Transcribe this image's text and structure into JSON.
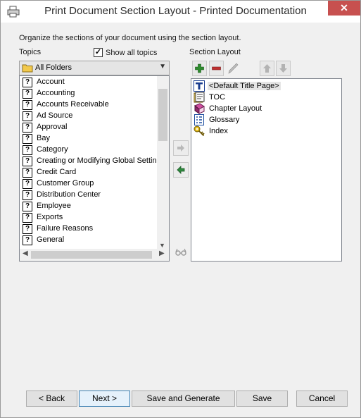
{
  "window": {
    "title": "Print Document Section Layout - Printed Documentation",
    "close_glyph": "✕"
  },
  "instruction": "Organize the sections of your document using the section layout.",
  "topics": {
    "label": "Topics",
    "show_all_label": "Show all topics",
    "show_all_checked": true,
    "folder_selected": "All Folders",
    "items": [
      "Account",
      "Accounting",
      "Accounts Receivable",
      "Ad Source",
      "Approval",
      "Bay",
      "Category",
      "Creating or Modifying Global Settings",
      "Credit Card",
      "Customer Group",
      "Distribution Center",
      "Employee",
      "Exports",
      "Failure Reasons",
      "General"
    ],
    "item_icon": "help-topic-icon",
    "item_icon_glyph": "?"
  },
  "section_layout": {
    "label": "Section Layout",
    "toolbar": [
      "add-icon",
      "remove-icon",
      "edit-pencil-icon",
      "move-up-icon",
      "move-down-icon"
    ],
    "items": [
      {
        "label": "<Default Title Page>",
        "icon": "title-page-icon",
        "selected": true
      },
      {
        "label": "TOC",
        "icon": "toc-book-icon"
      },
      {
        "label": "Chapter Layout",
        "icon": "chapter-book-icon"
      },
      {
        "label": "Glossary",
        "icon": "glossary-list-icon"
      },
      {
        "label": "Index",
        "icon": "index-key-icon"
      }
    ]
  },
  "transfer_buttons": [
    "move-right-icon",
    "move-left-icon",
    "preview-glasses-icon"
  ],
  "footer": {
    "back": "< Back",
    "next": "Next >",
    "save_generate": "Save and Generate",
    "save": "Save",
    "cancel": "Cancel"
  },
  "colors": {
    "close": "#c7504f",
    "add_green": "#2e8b2e",
    "remove_red": "#c03030"
  }
}
